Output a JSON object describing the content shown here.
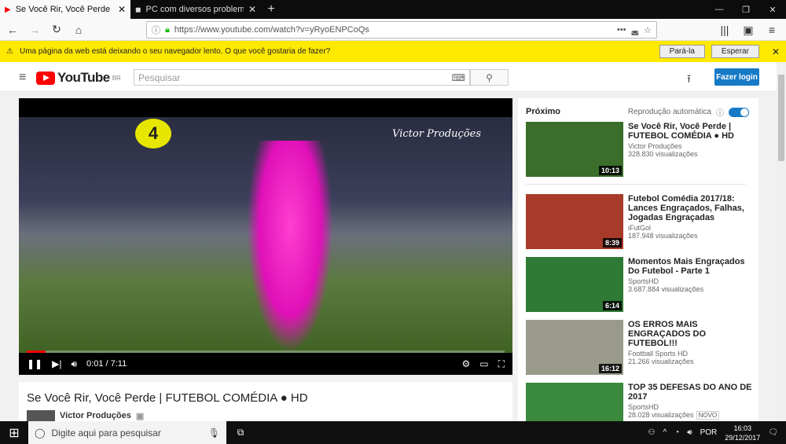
{
  "browser": {
    "tabs": [
      {
        "title": "Se Você Rir, Você Perde | FUTEB",
        "active": true
      },
      {
        "title": "PC com diversos problemas - P",
        "active": false
      }
    ],
    "url": "https://www.youtube.com/watch?v=yRyoENPCoQs",
    "notification": {
      "message": "Uma página da web está deixando o seu navegador lento. O que você gostaria de fazer?",
      "stop_label": "Pará-la",
      "wait_label": "Esperar"
    }
  },
  "youtube": {
    "logo_text": "YouTube",
    "region": "BR",
    "search_placeholder": "Pesquisar",
    "login_label": "Fazer login",
    "player": {
      "badge": "4",
      "watermark": "Victor Produções",
      "time": "0:01 / 7:11",
      "progress": 0.002
    },
    "video_title": "Se Você Rir, Você Perde | FUTEBOL COMÉDIA ● HD",
    "channel_name": "Victor Produções",
    "sidebar": {
      "up_next": "Próximo",
      "autoplay_label": "Reprodução automática",
      "autoplay_on": true,
      "items": [
        {
          "title": "Se Você Rir, Você Perde | FUTEBOL COMÉDIA ● HD",
          "channel": "Victor Produções",
          "views": "328.830 visualizações",
          "duration": "10:13",
          "color": "#3a6e2a"
        },
        {
          "title": "Futebol Comédia 2017/18: Lances Engraçados, Falhas, Jogadas Engraçadas",
          "channel": "iFutGol",
          "views": "187.948 visualizações",
          "duration": "8:39",
          "color": "#a83a2a"
        },
        {
          "title": "Momentos Mais Engraçados Do Futebol - Parte 1",
          "channel": "SportsHD",
          "views": "3.687.884 visualizações",
          "duration": "6:14",
          "color": "#2f7a35"
        },
        {
          "title": "OS ERROS MAIS ENGRAÇADOS DO FUTEBOL!!!",
          "channel": "Football Sports HD",
          "views": "21.266 visualizações",
          "duration": "16:12",
          "color": "#9a9a8a"
        },
        {
          "title": "TOP 35 DEFESAS DO ANO DE 2017",
          "channel": "SportsHD",
          "views": "28.028 visualizações",
          "badge": "NOVO",
          "duration": "",
          "color": "#3b8a3e"
        }
      ]
    }
  },
  "taskbar": {
    "search_placeholder": "Digite aqui para pesquisar",
    "language": "POR",
    "time": "16:03",
    "date": "29/12/2017"
  }
}
